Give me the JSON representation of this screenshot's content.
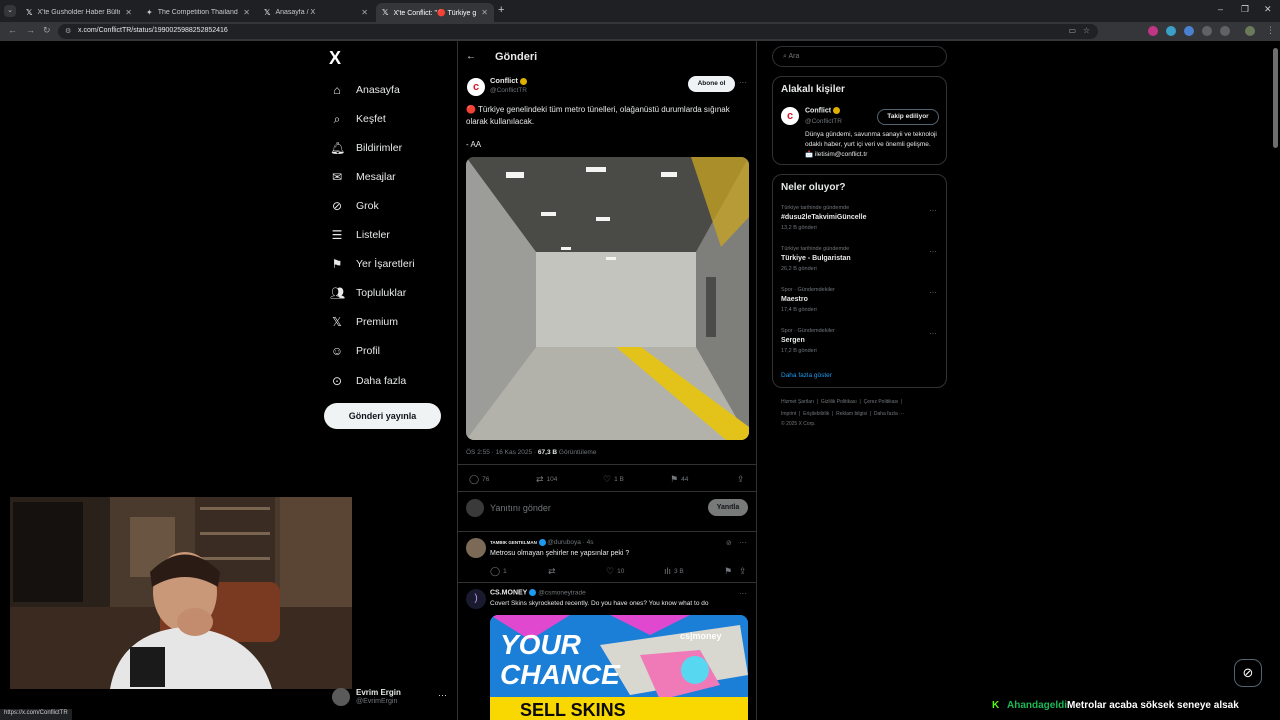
{
  "browser": {
    "tabs": [
      {
        "label": "X'te Gusholder Haber Bülteni: \""
      },
      {
        "label": "The Competition Thailand | Mi..."
      },
      {
        "label": "Anasayfa / X"
      },
      {
        "label": "X'te Conflict: \"🔴 Türkiye gene..."
      }
    ],
    "url": "x.com/ConflictTR/status/1990025988252852416",
    "status_url": "https://x.com/ConflictTR"
  },
  "nav": {
    "logo": "X",
    "items": [
      {
        "label": "Anasayfa",
        "icon": "home-icon"
      },
      {
        "label": "Keşfet",
        "icon": "search-icon"
      },
      {
        "label": "Bildirimler",
        "icon": "bell-icon"
      },
      {
        "label": "Mesajlar",
        "icon": "mail-icon"
      },
      {
        "label": "Grok",
        "icon": "grok-icon"
      },
      {
        "label": "Listeler",
        "icon": "list-icon"
      },
      {
        "label": "Yer İşaretleri",
        "icon": "bookmark-icon"
      },
      {
        "label": "Topluluklar",
        "icon": "communities-icon"
      },
      {
        "label": "Premium",
        "icon": "x-icon"
      },
      {
        "label": "Profil",
        "icon": "profile-icon"
      },
      {
        "label": "Daha fazla",
        "icon": "more-circle-icon"
      }
    ],
    "post_button": "Gönderi yayınla",
    "account": {
      "name": "Evrim Ergin",
      "handle": "@EvrimErgin"
    }
  },
  "post": {
    "header_title": "Gönderi",
    "author_name": "Conflict",
    "author_handle": "@ConflictTR",
    "subscribe_label": "Abone ol",
    "text_line1": "🔴 Türkiye genelindeki tüm metro tünelleri, olağanüstü durumlarda sığınak olarak kullanılacak.",
    "text_line2": "- AA",
    "timestamp": "ÖS 2:55 · 16 Kas 2025 ·",
    "views_count": "67,3 B",
    "views_label": "Görüntüleme",
    "replies": "76",
    "reposts": "104",
    "likes": "1 B",
    "bookmarks": "44",
    "reply_placeholder": "Yanıtını gönder",
    "reply_button": "Yanıtla"
  },
  "replies": [
    {
      "name": "TAMBIK GENTELMAN",
      "handle": "@duruboya · 4s",
      "text": "Metrosu olmayan şehirler ne yapsınlar peki ?",
      "reply_count": "1",
      "like_count": "10",
      "view_count": "3 B"
    },
    {
      "name": "CS.MONEY",
      "handle": "@csmoneytrade",
      "text": "Covert Skins skyrocketed recently. Do you have ones? You know what to do",
      "ad_brand": "cs|money",
      "ad_line1": "YOUR",
      "ad_line2": "CHANCE",
      "ad_line3": "SELL SKINS"
    }
  ],
  "right": {
    "search_placeholder": "Ara",
    "related_title": "Alakalı kişiler",
    "related_name": "Conflict",
    "related_handle": "@ConflictTR",
    "related_bio": "Dünya gündemi, savunma sanayii ve teknoloji odaklı haber, yurt içi veri ve önemli gelişme. 📩 iletisim@conflict.tr",
    "follow_label": "Takip ediliyor",
    "trends_title": "Neler oluyor?",
    "trends": [
      {
        "category": "Türkiye tarihinde gündemde",
        "name": "#dusu2leTakvimiGüncelle",
        "count": "13,2 B gönderi"
      },
      {
        "category": "Türkiye tarihinde gündemde",
        "name": "Türkiye - Bulgaristan",
        "count": "26,2 B gönderi"
      },
      {
        "category": "Spor · Gündemdekiler",
        "name": "Maestro",
        "count": "17,4 B gönderi"
      },
      {
        "category": "Spor · Gündemdekiler",
        "name": "Sergen",
        "count": "17,2 B gönderi"
      }
    ],
    "show_more": "Daha fazla göster",
    "footer_line1": [
      "Hizmet Şartları",
      "Gizlilik Politikası",
      "Çerez Politikası"
    ],
    "footer_line2": [
      "Imprint",
      "Erişilebilirlik",
      "Reklam bilgisi",
      "Daha fazla ···"
    ],
    "copyright": "© 2025 X Corp."
  },
  "stream": {
    "chat_user": "Ahandageldi",
    "chat_text": "Metrolar acaba söksek seneye alsak"
  },
  "colors": {
    "accent": "#1d9bf0",
    "background": "#000000",
    "border": "#2f3336",
    "live_red": "#e0245e"
  }
}
